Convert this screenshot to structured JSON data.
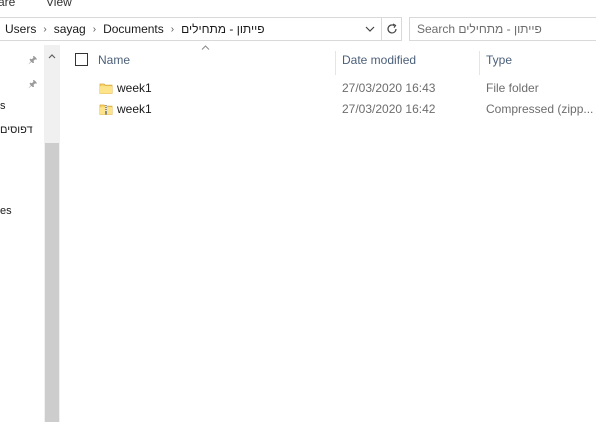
{
  "ribbon": {
    "tabs": [
      "are",
      "View"
    ]
  },
  "address": {
    "crumbs": [
      "Users",
      "sayag",
      "Documents",
      "פייתון - מתחילים"
    ],
    "dropdown_icon": "chevron-down-icon",
    "refresh_icon": "refresh-icon"
  },
  "search": {
    "placeholder": "Search פייתון - מתחילים"
  },
  "nav": {
    "items": [
      "s",
      "דפוסים",
      "es"
    ]
  },
  "columns": {
    "name": "Name",
    "date": "Date modified",
    "type": "Type"
  },
  "files": [
    {
      "name": "week1",
      "date": "27/03/2020 16:43",
      "type": "File folder",
      "icon": "folder-icon"
    },
    {
      "name": "week1",
      "date": "27/03/2020 16:42",
      "type": "Compressed (zipp...",
      "icon": "zip-folder-icon"
    }
  ]
}
